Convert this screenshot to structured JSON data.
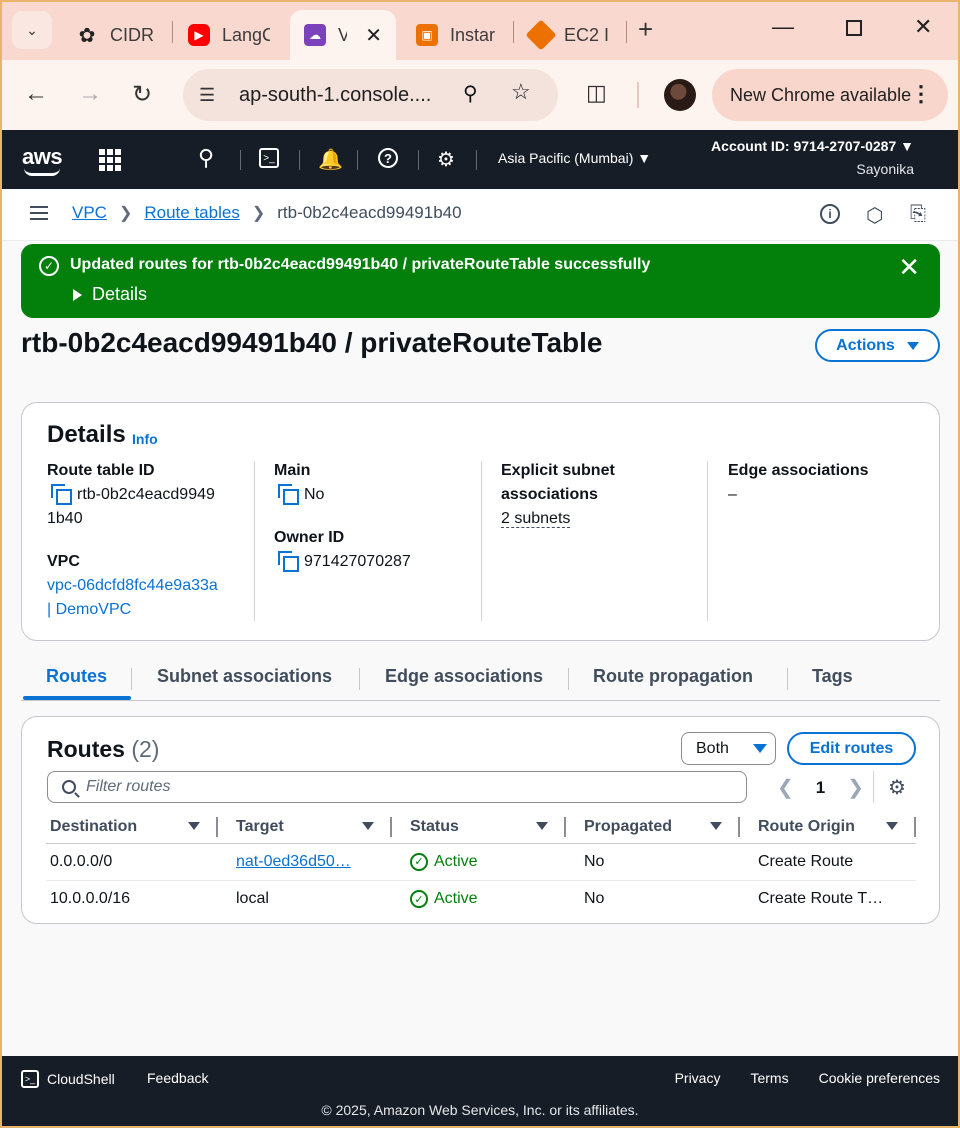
{
  "browser": {
    "tabs": [
      {
        "title": "CIDR",
        "icon": "openai-icon",
        "color": "#ffffff"
      },
      {
        "title": "LangC",
        "icon": "youtube-icon",
        "color": "#ff0000"
      },
      {
        "title": "V",
        "icon": "vpc-icon",
        "color": "#7b42bc"
      },
      {
        "title": "Instar",
        "icon": "ec2-icon",
        "color": "#ed7100"
      },
      {
        "title": "EC2 I",
        "icon": "ec2-cube-icon",
        "color": "#ed7100"
      }
    ],
    "url": "ap-south-1.console....",
    "update_label": "New Chrome available"
  },
  "aws": {
    "logo": "aws",
    "region": "Asia Pacific (Mumbai)",
    "account": "Account ID: 9714-2707-0287",
    "user": "Sayonika"
  },
  "breadcrumb": {
    "items": [
      "VPC",
      "Route tables"
    ],
    "current": "rtb-0b2c4eacd99491b40"
  },
  "flash": {
    "message": "Updated routes for rtb-0b2c4eacd99491b40 / privateRouteTable successfully",
    "details_label": "Details"
  },
  "page": {
    "title": "rtb-0b2c4eacd99491b40 / privateRouteTable",
    "actions_label": "Actions"
  },
  "details": {
    "heading": "Details",
    "info": "Info",
    "route_table_id_label": "Route table ID",
    "route_table_id_line1": "rtb-0b2c4eacd9949",
    "route_table_id_line2": "1b40",
    "vpc_label": "VPC",
    "vpc_line1": "vpc-06dcfd8fc44e9a33a",
    "vpc_line2": "| DemoVPC",
    "main_label": "Main",
    "main_value": "No",
    "owner_label": "Owner ID",
    "owner_value": "971427070287",
    "explicit_label_1": "Explicit subnet",
    "explicit_label_2": "associations",
    "explicit_value": "2 subnets",
    "edge_label": "Edge associations",
    "edge_value": "–"
  },
  "tabs": [
    "Routes",
    "Subnet associations",
    "Edge associations",
    "Route propagation",
    "Tags"
  ],
  "routes": {
    "heading": "Routes",
    "count": "(2)",
    "filter_select": "Both",
    "edit_label": "Edit routes",
    "filter_placeholder": "Filter routes",
    "page": "1",
    "columns": [
      "Destination",
      "Target",
      "Status",
      "Propagated",
      "Route Origin"
    ],
    "rows": [
      {
        "destination": "0.0.0.0/0",
        "target": "nat-0ed36d50…",
        "status": "Active",
        "propagated": "No",
        "origin": "Create Route"
      },
      {
        "destination": "10.0.0.0/16",
        "target": "local",
        "status": "Active",
        "propagated": "No",
        "origin": "Create Route T…"
      }
    ]
  },
  "footer": {
    "cloudshell": "CloudShell",
    "feedback": "Feedback",
    "links": [
      "Privacy",
      "Terms",
      "Cookie preferences"
    ],
    "copyright": "© 2025, Amazon Web Services, Inc. or its affiliates."
  }
}
